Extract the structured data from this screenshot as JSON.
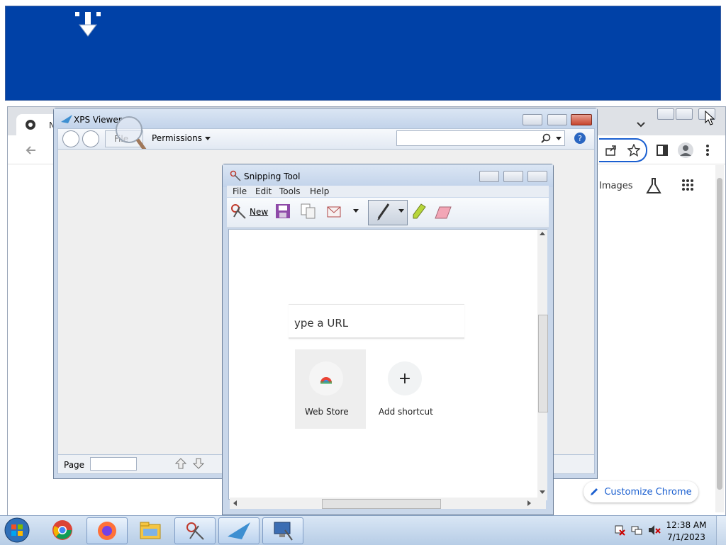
{
  "chrome": {
    "tab_title": "N",
    "images_link": "Images",
    "customize_label": "Customize Chrome"
  },
  "xps": {
    "title": "XPS Viewer",
    "menu_file": "File",
    "menu_permissions": "Permissions",
    "page_label": "Page"
  },
  "snip": {
    "title": "Snipping Tool",
    "menu": [
      "File",
      "Edit",
      "Tools",
      "Help"
    ],
    "new_label": "New",
    "captured": {
      "url_placeholder": "ype a URL",
      "tile_webstore": "Web Store",
      "tile_add": "Add shortcut"
    }
  },
  "taskbar": {
    "time": "12:38 AM",
    "date": "7/1/2023"
  }
}
